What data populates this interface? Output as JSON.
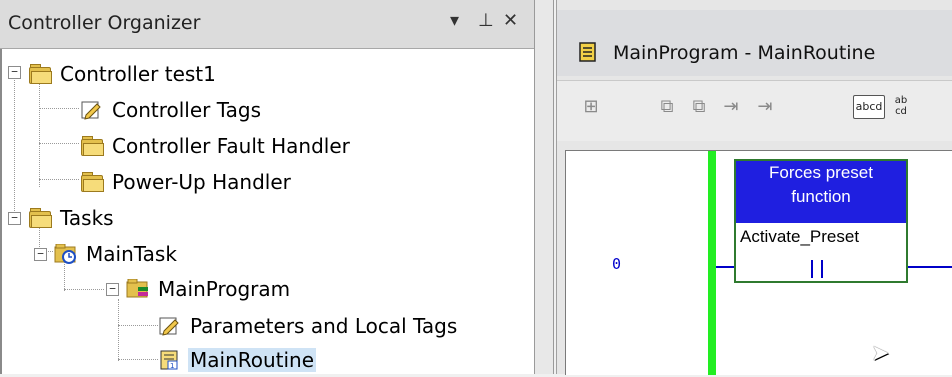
{
  "organizer": {
    "title": "Controller Organizer",
    "buttons": {
      "pin_menu": "▾",
      "auto_hide": "⊥",
      "close": "✕"
    },
    "tree": [
      {
        "label": "Controller test1",
        "icon": "folder-icon"
      },
      {
        "label": "Controller Tags",
        "icon": "tags-icon"
      },
      {
        "label": "Controller Fault Handler",
        "icon": "folder-icon"
      },
      {
        "label": "Power-Up Handler",
        "icon": "folder-icon"
      },
      {
        "label": "Tasks",
        "icon": "folder-icon"
      },
      {
        "label": "MainTask",
        "icon": "task-icon"
      },
      {
        "label": "MainProgram",
        "icon": "program-icon"
      },
      {
        "label": "Parameters and Local Tags",
        "icon": "tags-icon"
      },
      {
        "label": "MainRoutine",
        "icon": "routine-icon",
        "selected": true
      }
    ]
  },
  "editor": {
    "title": "MainProgram - MainRoutine",
    "toolbar": {
      "abcd_label": "abcd",
      "ab_cd_label": "ab cd"
    },
    "rung_number": "0",
    "instruction": {
      "tooltip_line1": "Forces preset",
      "tooltip_line2": "function",
      "operand": "Activate_Preset"
    }
  },
  "colors": {
    "power_rail": "#22ee22",
    "rung": "#0000c8",
    "tooltip_bg": "#1f1fe0",
    "selection": "#cfe3f5"
  }
}
